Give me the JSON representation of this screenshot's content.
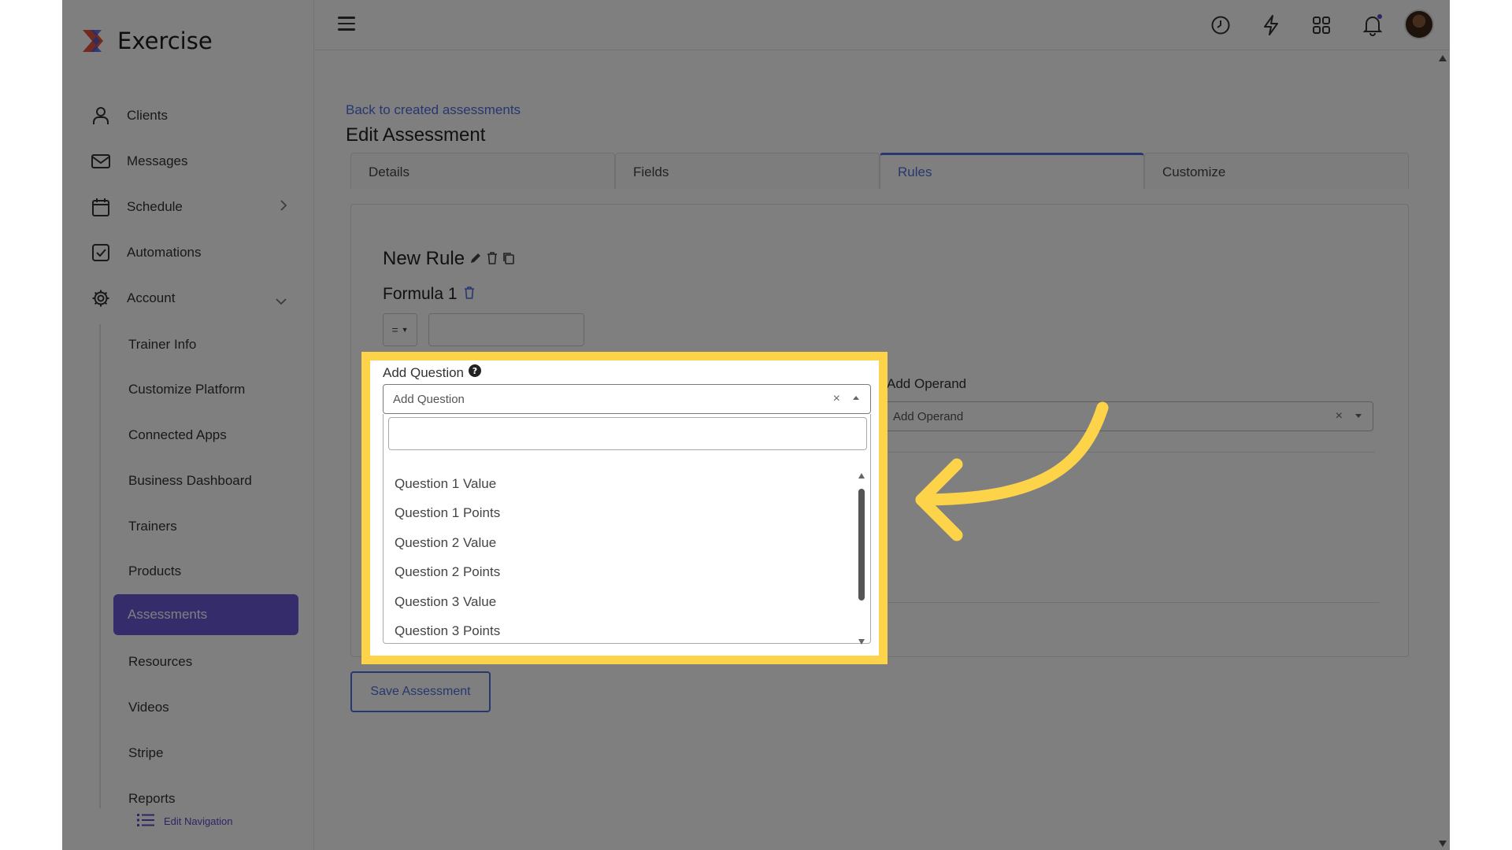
{
  "brand": {
    "name": "Exercise"
  },
  "sidebar": {
    "items": [
      {
        "label": "Clients",
        "icon": "user-icon"
      },
      {
        "label": "Messages",
        "icon": "mail-icon"
      },
      {
        "label": "Schedule",
        "icon": "calendar-icon"
      },
      {
        "label": "Automations",
        "icon": "checkbox-icon"
      },
      {
        "label": "Account",
        "icon": "gear-icon"
      }
    ],
    "account_sub": [
      {
        "label": "Trainer Info"
      },
      {
        "label": "Customize Platform"
      },
      {
        "label": "Connected Apps"
      },
      {
        "label": "Business Dashboard"
      },
      {
        "label": "Trainers"
      },
      {
        "label": "Products"
      },
      {
        "label": "Assessments",
        "active": true
      },
      {
        "label": "Resources"
      },
      {
        "label": "Videos"
      },
      {
        "label": "Stripe"
      },
      {
        "label": "Reports"
      }
    ],
    "edit_nav": "Edit Navigation"
  },
  "page": {
    "back_link": "Back to created assessments",
    "title": "Edit Assessment",
    "tabs": [
      {
        "label": "Details"
      },
      {
        "label": "Fields"
      },
      {
        "label": "Rules",
        "active": true
      },
      {
        "label": "Customize"
      }
    ]
  },
  "rule": {
    "title": "New Rule",
    "formula_title": "Formula 1",
    "operator": "=",
    "formula_value": "",
    "add_question_label": "Add Question",
    "add_question_placeholder": "Add Question",
    "add_operand_label": "Add Operand",
    "add_operand_placeholder": "Add Operand",
    "clear_symbol": "×",
    "dropdown_search": "",
    "dropdown_options": [
      "Question 1 Value",
      "Question 1 Points",
      "Question 2 Value",
      "Question 2 Points",
      "Question 3 Value",
      "Question 3 Points"
    ]
  },
  "actions": {
    "save": "Save Assessment"
  },
  "colors": {
    "accent": "#6b58d6",
    "link": "#4f6fe0",
    "highlight": "#fdd34a",
    "overlay": "rgba(0,0,0,0.5)"
  },
  "topbar_icons": [
    "clock-icon",
    "bolt-icon",
    "grid-icon",
    "bell-icon"
  ]
}
